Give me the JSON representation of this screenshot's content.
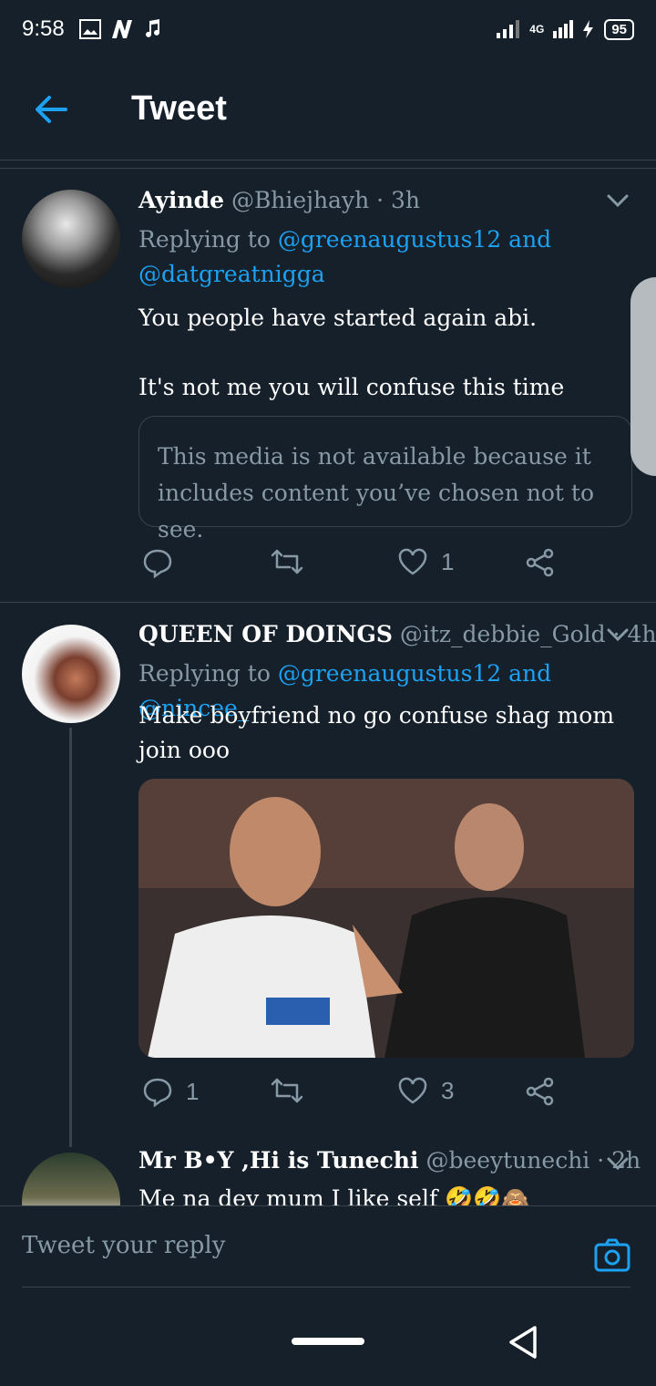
{
  "status": {
    "time": "9:58",
    "network": "4G",
    "battery": "95"
  },
  "appbar": {
    "title": "Tweet"
  },
  "tweets": [
    {
      "name": "Ayinde",
      "handle_time": "@Bhiejhayh · 3h",
      "reply_prefix": "Replying to",
      "mention_1": "@greenaugustus12 and",
      "mention_2": "@datgreatnigga",
      "text_1": "You people have started again abi.",
      "text_2": "It's not me you will confuse this time",
      "media_notice": "This media is not available because it includes content you’ve chosen not to see.",
      "likes": "1"
    },
    {
      "name": "QUEEN OF DOINGS",
      "handle_time": "@itz_debbie_Gold · 4h",
      "reply_prefix": "Replying to",
      "mentions": "@greenaugustus12 and @nincee_",
      "text": "Make boyfriend no go confuse shag mom join ooo",
      "replies": "1",
      "likes": "3"
    },
    {
      "name": "Mr B•Y ,Hi is Tunechi",
      "handle_time": "@beeytunechi · 2h",
      "text": "Me na dey mum I like self 🤣🤣🙈"
    }
  ],
  "compose": {
    "placeholder": "Tweet your reply"
  },
  "colors": {
    "accent": "#1da1f2",
    "background": "#15202b",
    "muted": "#8899a6",
    "divider": "#38444d"
  }
}
